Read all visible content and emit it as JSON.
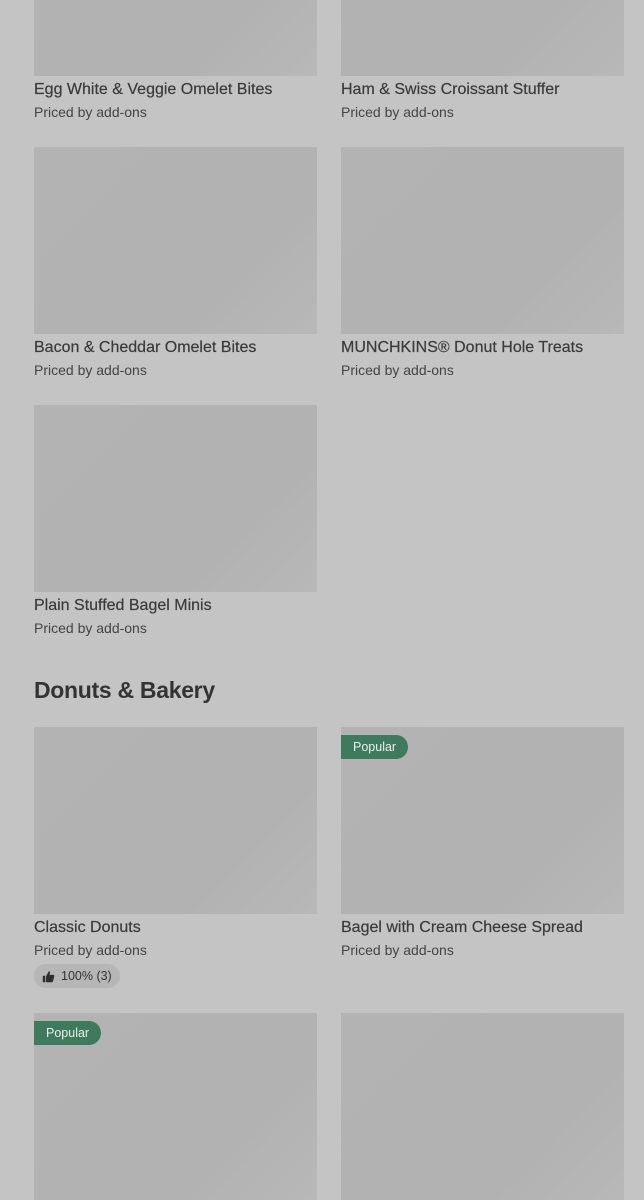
{
  "sections": [
    {
      "items": [
        {
          "name": "Egg White & Veggie Omelet Bites",
          "price": "Priced by add-ons"
        },
        {
          "name": "Ham & Swiss Croissant Stuffer",
          "price": "Priced by add-ons"
        },
        {
          "name": "Bacon & Cheddar Omelet Bites",
          "price": "Priced by add-ons"
        },
        {
          "name": "MUNCHKINS® Donut Hole Treats",
          "price": "Priced by add-ons"
        },
        {
          "name": "Plain Stuffed Bagel Minis",
          "price": "Priced by add-ons"
        }
      ]
    },
    {
      "title": "Donuts & Bakery",
      "items": [
        {
          "name": "Classic Donuts",
          "price": "Priced by add-ons",
          "rating": "100% (3)"
        },
        {
          "name": "Bagel with Cream Cheese Spread",
          "price": "Priced by add-ons",
          "badge": "Popular"
        },
        {
          "badge": "Popular"
        },
        {}
      ]
    }
  ],
  "colors": {
    "background": "#c4c4c4",
    "image_placeholder": "#b3b3b3",
    "popular_badge": "#3e7a5b",
    "rating_pill": "#b6b6b6"
  },
  "icons": {
    "rating": "thumbs-up-icon"
  }
}
